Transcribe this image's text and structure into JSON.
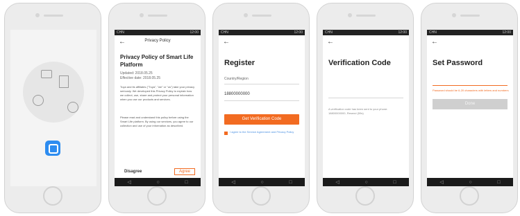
{
  "phones": {
    "splash": {
      "label": "App launch screen"
    },
    "privacy": {
      "header_title": "Privacy Policy",
      "back_icon": "back-arrow",
      "doc_title": "Privacy Policy of Smart Life Platform",
      "meta_1": "Updated: 2018.05.25",
      "meta_2": "Effective date: 2018.05.25",
      "body_1": "Tuya and its affiliates (\"Tuya\", \"we\" or \"us\") take your privacy seriously. We developed this Privacy Policy to explain how we collect, use, share and protect your personal information when you use our products and services.",
      "body_2": "Please read and understand this policy before using the Smart Life platform. By using our services, you agree to our collection and use of your information as described.",
      "disagree_label": "Disagree",
      "agree_label": "Agree"
    },
    "register": {
      "title": "Register",
      "country_label": "Country/Region",
      "country_value": "China",
      "phone_value": "18800000000",
      "get_code_label": "Get Verification Code",
      "agree_text": "I agree to the Service Agreement and Privacy Policy"
    },
    "verify": {
      "title": "Verification Code",
      "hint": "A verification code has been sent to your phone: 18800000000, Resend (59s)"
    },
    "password": {
      "title": "Set Password",
      "error_hint": "Password should be 6-20 characters with letters and numbers",
      "done_label": "Done"
    }
  },
  "statusbar": {
    "left": "CHN",
    "right": "12:00"
  },
  "colors": {
    "accent": "#f26b21",
    "launcher_icon": "#2d8cf0"
  }
}
